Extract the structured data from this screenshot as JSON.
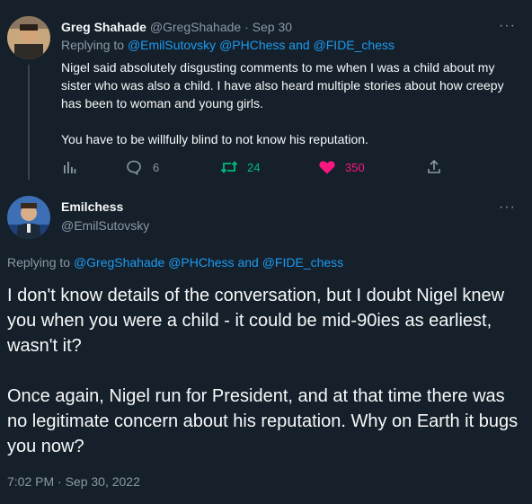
{
  "tweet1": {
    "author_name": "Greg Shahade",
    "author_handle": "@GregShahade",
    "separator": "·",
    "date": "Sep 30",
    "replying_prefix": "Replying to",
    "reply_user1": "@EmilSutovsky",
    "reply_user2": "@PHChess",
    "reply_and": "and",
    "reply_user3": "@FIDE_chess",
    "body_p1": "Nigel said absolutely disgusting comments to me when I was a child about my sister who was also a child. I have also heard multiple stories about how creepy has been to woman and young girls.",
    "body_p2": "You have to be willfully blind to not know his reputation.",
    "more": "···",
    "replies": "6",
    "retweets": "24",
    "likes": "350"
  },
  "tweet2": {
    "author_name": "Emilchess",
    "author_handle": "@EmilSutovsky",
    "more": "···",
    "replying_prefix": "Replying to",
    "reply_user1": "@GregShahade",
    "reply_user2": "@PHChess",
    "reply_and": "and",
    "reply_user3": "@FIDE_chess",
    "body_p1": "I don't know details of the conversation, but I doubt Nigel knew you when you were a child - it could be mid-90ies as earliest, wasn't it?",
    "body_p2": "Once again, Nigel run for President, and at that time there was no legitimate concern about his reputation. Why on Earth it bugs you now?",
    "timestamp": "7:02 PM · Sep 30, 2022"
  },
  "colors": {
    "background": "#15202b",
    "text": "#f7f9f9",
    "muted": "#8b98a5",
    "link": "#1d9bf0",
    "retweet": "#00ba7c",
    "like": "#f91880"
  },
  "icons": [
    "analytics-icon",
    "reply-icon",
    "retweet-icon",
    "like-icon",
    "share-icon",
    "more-icon"
  ]
}
